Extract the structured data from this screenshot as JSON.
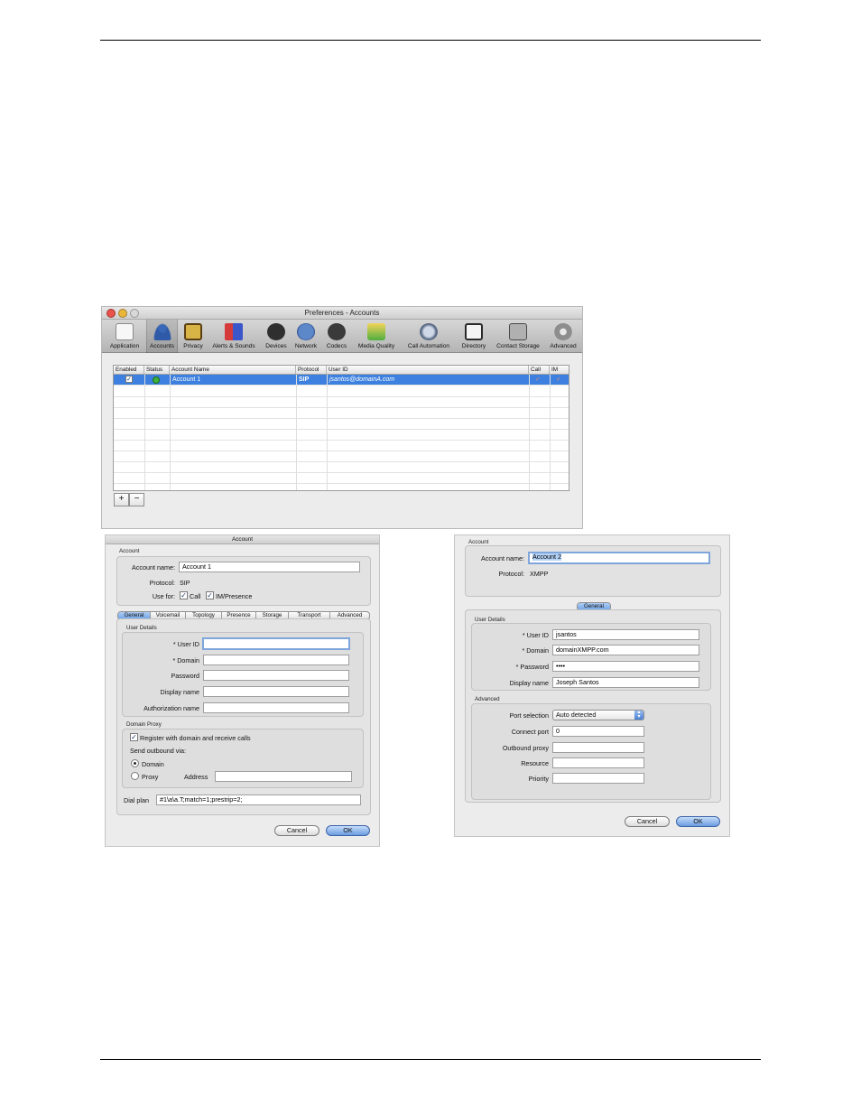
{
  "preferences": {
    "title": "Preferences - Accounts",
    "toolbar": [
      {
        "label": "Application",
        "icon": "application-icon"
      },
      {
        "label": "Accounts",
        "icon": "accounts-icon"
      },
      {
        "label": "Privacy",
        "icon": "privacy-icon"
      },
      {
        "label": "Alerts & Sounds",
        "icon": "alerts-sounds-icon"
      },
      {
        "label": "Devices",
        "icon": "headset-icon"
      },
      {
        "label": "Network",
        "icon": "network-globe-icon"
      },
      {
        "label": "Codecs",
        "icon": "codecs-film-icon"
      },
      {
        "label": "Media Quality",
        "icon": "media-quality-icon"
      },
      {
        "label": "Call Automation",
        "icon": "call-automation-icon"
      },
      {
        "label": "Directory",
        "icon": "directory-book-icon"
      },
      {
        "label": "Contact Storage",
        "icon": "contact-storage-icon"
      },
      {
        "label": "Advanced",
        "icon": "advanced-gear-icon"
      }
    ],
    "selected_tab": "Accounts",
    "table": {
      "headers": [
        "Enabled",
        "Status",
        "Account Name",
        "Protocol",
        "User ID",
        "Call",
        "IM"
      ],
      "row": {
        "enabled": "☑",
        "account_name": "Account 1",
        "protocol": "SIP",
        "user_id": "jsantos@domainA.com",
        "call": "✓",
        "im": "✓"
      }
    },
    "add_label": "+",
    "remove_label": "−"
  },
  "sip_dialog": {
    "title": "Account",
    "account_group": "Account",
    "account_name_label": "Account name:",
    "account_name": "Account 1",
    "protocol_label": "Protocol:",
    "protocol": "SIP",
    "use_for_label": "Use for:",
    "call_label": "Call",
    "im_label": "IM/Presence",
    "tabs": [
      "General",
      "Voicemail",
      "Topology",
      "Presence",
      "Storage",
      "Transport",
      "Advanced"
    ],
    "user_details_group": "User Details",
    "user_id_label": "* User ID",
    "domain_label": "* Domain",
    "password_label": "Password",
    "display_name_label": "Display name",
    "auth_name_label": "Authorization name",
    "domain_proxy_group": "Domain Proxy",
    "register_label": "Register with domain and receive calls",
    "send_outbound_label": "Send outbound via:",
    "domain_option": "Domain",
    "proxy_option": "Proxy",
    "address_label": "Address",
    "dial_plan_label": "Dial plan",
    "dial_plan": "#1\\a\\a.T;match=1;prestrip=2;",
    "cancel": "Cancel",
    "ok": "OK"
  },
  "xmpp_dialog": {
    "account_group": "Account",
    "account_name_label": "Account name:",
    "account_name": "Account 2",
    "protocol_label": "Protocol:",
    "protocol": "XMPP",
    "tab": "General",
    "user_details_group": "User Details",
    "user_id_label": "* User ID",
    "user_id": "jsantos",
    "domain_label": "* Domain",
    "domain": "domainXMPP.com",
    "password_label": "* Password",
    "password": "••••",
    "display_name_label": "Display name",
    "display_name": "Joseph Santos",
    "advanced_group": "Advanced",
    "port_selection_label": "Port selection",
    "port_selection": "Auto detected",
    "connect_port_label": "Connect port",
    "connect_port": "0",
    "outbound_proxy_label": "Outbound proxy",
    "resource_label": "Resource",
    "priority_label": "Priority",
    "cancel": "Cancel",
    "ok": "OK"
  },
  "colors": {
    "selection": "#3d80df",
    "status_online": "#3db23a",
    "default_button": "#6b9ce0"
  }
}
